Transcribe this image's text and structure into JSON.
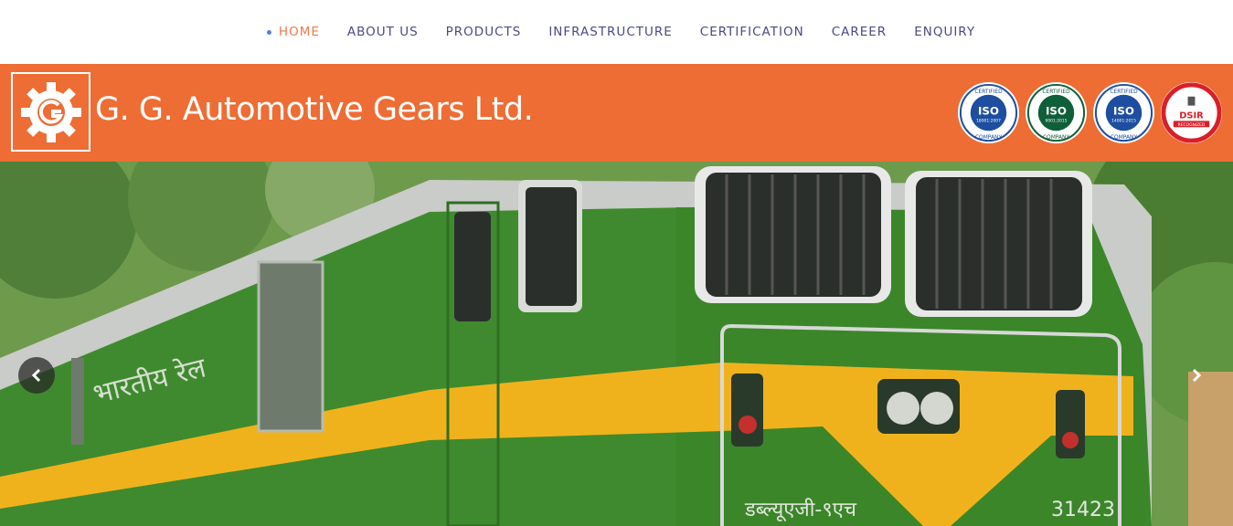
{
  "nav": {
    "items": [
      {
        "label": "HOME",
        "active": true
      },
      {
        "label": "ABOUT US"
      },
      {
        "label": "PRODUCTS"
      },
      {
        "label": "INFRASTRUCTURE"
      },
      {
        "label": "CERTIFICATION"
      },
      {
        "label": "CAREER"
      },
      {
        "label": "ENQUIRY"
      }
    ]
  },
  "header": {
    "company_name": "G. G. Automotive Gears Ltd.",
    "logo_icon": "gear-logo-icon",
    "badges": [
      {
        "top": "CERTIFIED",
        "mark": "ISO",
        "code": "18001:2007",
        "bottom": "COMPANY",
        "color": "#1d4ea0"
      },
      {
        "top": "CERTIFIED",
        "mark": "ISO",
        "code": "9001:2015",
        "bottom": "COMPANY",
        "color": "#0f5f3a"
      },
      {
        "top": "CERTIFIED",
        "mark": "ISO",
        "code": "14001:2015",
        "bottom": "COMPANY",
        "color": "#1d4ea0"
      },
      {
        "mark": "DSIR",
        "code": "RECOGNIZED",
        "color": "#d8202a"
      }
    ]
  },
  "hero": {
    "locomotive_hindi_text": "भारतीय रेल",
    "locomotive_class": "डब्ल्यूएजी-९एच",
    "locomotive_number": "31423",
    "prev_icon": "chevron-left-icon",
    "next_icon": "chevron-right-icon",
    "colors": {
      "body": "#3f8a2e",
      "stripe": "#f0b21c",
      "roof": "#c9ccc8"
    }
  }
}
